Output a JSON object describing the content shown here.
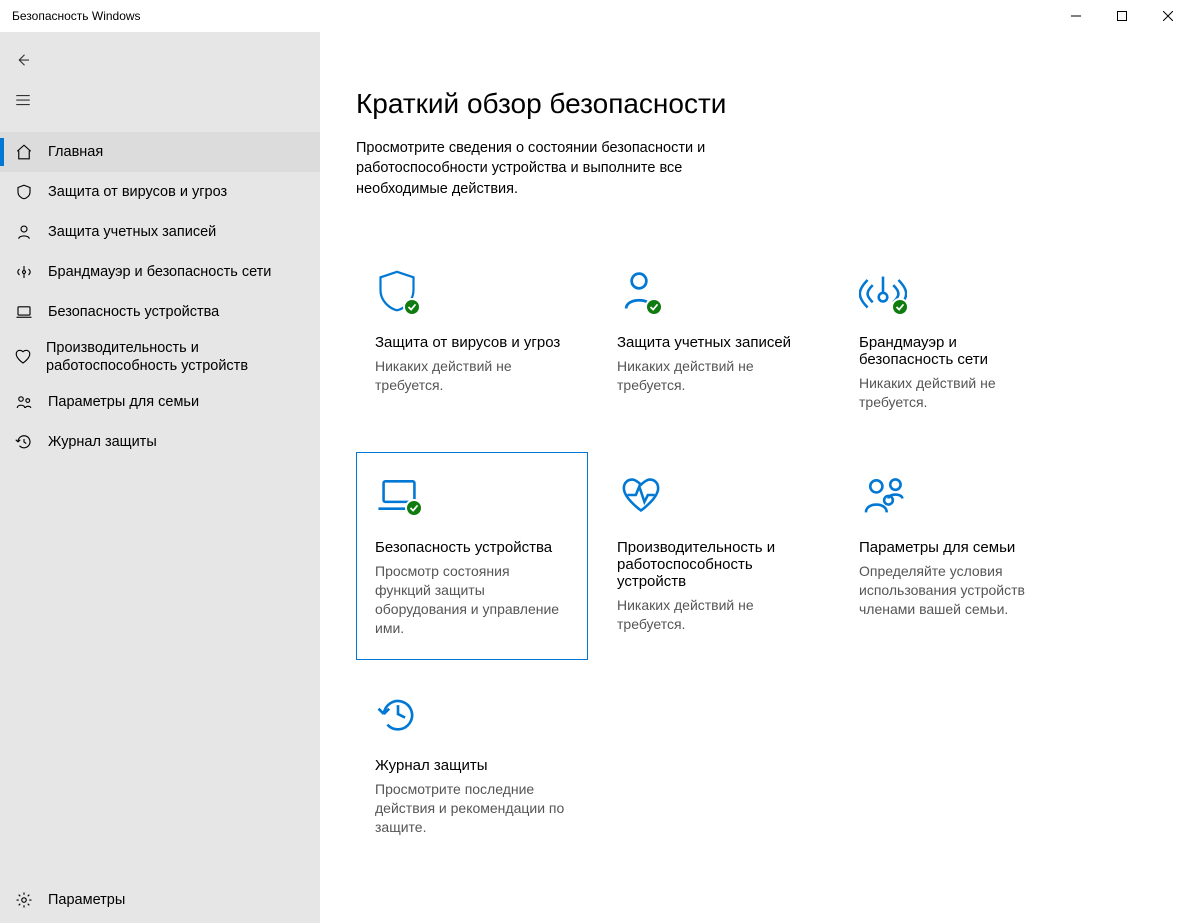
{
  "window": {
    "title": "Безопасность Windows"
  },
  "sidebar": {
    "items": [
      {
        "label": "Главная"
      },
      {
        "label": "Защита от вирусов и угроз"
      },
      {
        "label": "Защита учетных записей"
      },
      {
        "label": "Брандмауэр и безопасность сети"
      },
      {
        "label": "Безопасность устройства"
      },
      {
        "label": "Производительность и работоспособность устройств"
      },
      {
        "label": "Параметры для семьи"
      },
      {
        "label": "Журнал защиты"
      }
    ],
    "settings_label": "Параметры"
  },
  "main": {
    "heading": "Краткий обзор безопасности",
    "subtitle": "Просмотрите сведения о состоянии безопасности и работоспособности устройства и выполните все необходимые действия."
  },
  "tiles": [
    {
      "title": "Защита от вирусов и угроз",
      "desc": "Никаких действий не требуется."
    },
    {
      "title": "Защита учетных записей",
      "desc": "Никаких действий не требуется."
    },
    {
      "title": "Брандмауэр и безопасность сети",
      "desc": "Никаких действий не требуется."
    },
    {
      "title": "Безопасность устройства",
      "desc": "Просмотр состояния функций защиты оборудования и управление ими."
    },
    {
      "title": "Производительность и работоспособность устройств",
      "desc": "Никаких действий не требуется."
    },
    {
      "title": "Параметры для семьи",
      "desc": "Определяйте условия использования устройств членами вашей семьи."
    },
    {
      "title": "Журнал защиты",
      "desc": "Просмотрите последние действия и рекомендации по защите."
    }
  ],
  "colors": {
    "accent": "#0078d4",
    "ok": "#107c10"
  }
}
